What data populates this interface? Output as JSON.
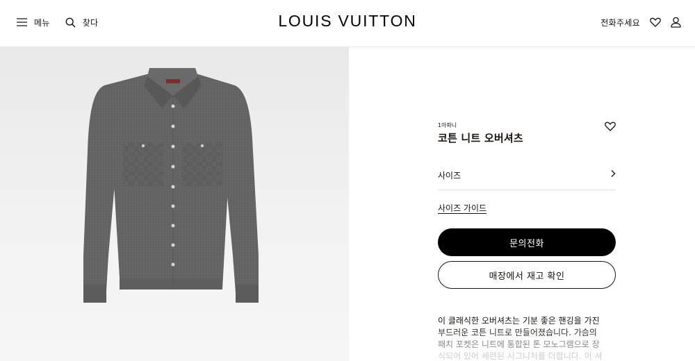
{
  "header": {
    "menu_label": "메뉴",
    "search_label": "찾다",
    "logo": "LOUIS VUITTON",
    "call_label": "전화주세요",
    "icons": {
      "menu": "menu-icon",
      "search": "search-icon",
      "wishlist": "heart-icon",
      "account": "user-icon"
    }
  },
  "product": {
    "sku": "1아파니",
    "name": "코튼 니트 오버셔츠",
    "size_label": "사이즈",
    "size_guide": "사이즈 가이드",
    "primary_button": "문의전화",
    "secondary_button": "매장에서 재고 확인",
    "description_lines": [
      "이 클래식한 오버셔츠는 기분 좋은 핸깅을 가진",
      "부드러운 코튼 니트로 만들어졌습니다. 가슴의",
      "패치 포켓은 니트에 통합된 톤 모노그램으로 장",
      "식되어 있어 세련된 시그니처를 더합니다. 이 셔"
    ],
    "image_alt": "grey-knit-overshirt-image"
  },
  "colors": {
    "accent": "#000000",
    "text": "#19110b",
    "shirt": "#636363",
    "background_gray": "#ececec"
  }
}
